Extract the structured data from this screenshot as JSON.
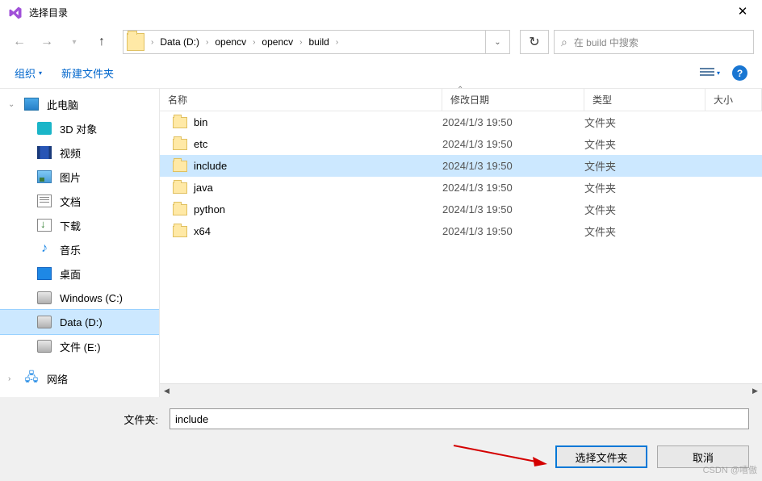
{
  "title": "选择目录",
  "breadcrumb": [
    "Data (D:)",
    "opencv",
    "opencv",
    "build"
  ],
  "search_placeholder": "在 build 中搜索",
  "toolbar": {
    "organize": "组织",
    "new_folder": "新建文件夹"
  },
  "sidebar": {
    "items": [
      {
        "label": "此电脑"
      },
      {
        "label": "3D 对象"
      },
      {
        "label": "视频"
      },
      {
        "label": "图片"
      },
      {
        "label": "文档"
      },
      {
        "label": "下载"
      },
      {
        "label": "音乐"
      },
      {
        "label": "桌面"
      },
      {
        "label": "Windows (C:)"
      },
      {
        "label": "Data (D:)"
      },
      {
        "label": "文件 (E:)"
      },
      {
        "label": "网络"
      }
    ]
  },
  "columns": {
    "name": "名称",
    "date": "修改日期",
    "type": "类型",
    "size": "大小"
  },
  "rows": [
    {
      "name": "bin",
      "date": "2024/1/3 19:50",
      "type": "文件夹"
    },
    {
      "name": "etc",
      "date": "2024/1/3 19:50",
      "type": "文件夹"
    },
    {
      "name": "include",
      "date": "2024/1/3 19:50",
      "type": "文件夹",
      "selected": true
    },
    {
      "name": "java",
      "date": "2024/1/3 19:50",
      "type": "文件夹"
    },
    {
      "name": "python",
      "date": "2024/1/3 19:50",
      "type": "文件夹"
    },
    {
      "name": "x64",
      "date": "2024/1/3 19:50",
      "type": "文件夹"
    }
  ],
  "folder_label": "文件夹:",
  "folder_value": "include",
  "buttons": {
    "select": "选择文件夹",
    "cancel": "取消"
  },
  "watermark": "CSDN @嘻傲"
}
